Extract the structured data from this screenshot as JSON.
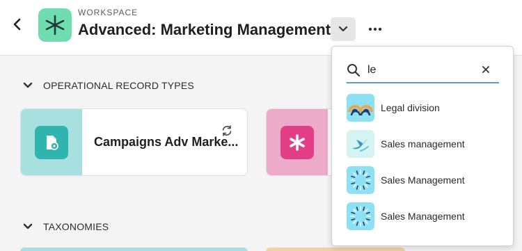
{
  "header": {
    "eyebrow": "WORKSPACE",
    "title": "Advanced: Marketing Management",
    "back_icon": "chevron-left-icon",
    "dropdown_icon": "chevron-down-icon",
    "more_icon": "more-horizontal-icon",
    "workspace_icon": "asterisk-icon",
    "workspace_icon_color": "#6fddb0"
  },
  "sections": [
    {
      "label": "OPERATIONAL RECORD TYPES",
      "icon": "chevron-down-icon"
    },
    {
      "label": "TAXONOMIES",
      "icon": "chevron-down-icon"
    }
  ],
  "cards": [
    {
      "title": "Campaigns Adv Marke...",
      "icon": "campaign-doc-icon",
      "strip_color": "#a8e0df",
      "tile_color": "#2fb5ae",
      "badge_icon": "sync-icon"
    },
    {
      "title": "",
      "icon": "asterisk-icon",
      "strip_color": "#eeaac9",
      "tile_color": "#e23e86"
    }
  ],
  "search": {
    "value": "le",
    "search_icon": "search-icon",
    "clear_icon": "close-icon"
  },
  "options": [
    {
      "label": "Legal division",
      "icon": "rainbow-icon",
      "bg": "#8ee0f3"
    },
    {
      "label": "Sales management",
      "icon": "bird-icon",
      "bg": "#d5f3f1"
    },
    {
      "label": "Sales Management",
      "icon": "sunburst-icon",
      "bg": "#8ee0f3"
    },
    {
      "label": "Sales Management",
      "icon": "sunburst-icon",
      "bg": "#8ee0f3"
    }
  ]
}
